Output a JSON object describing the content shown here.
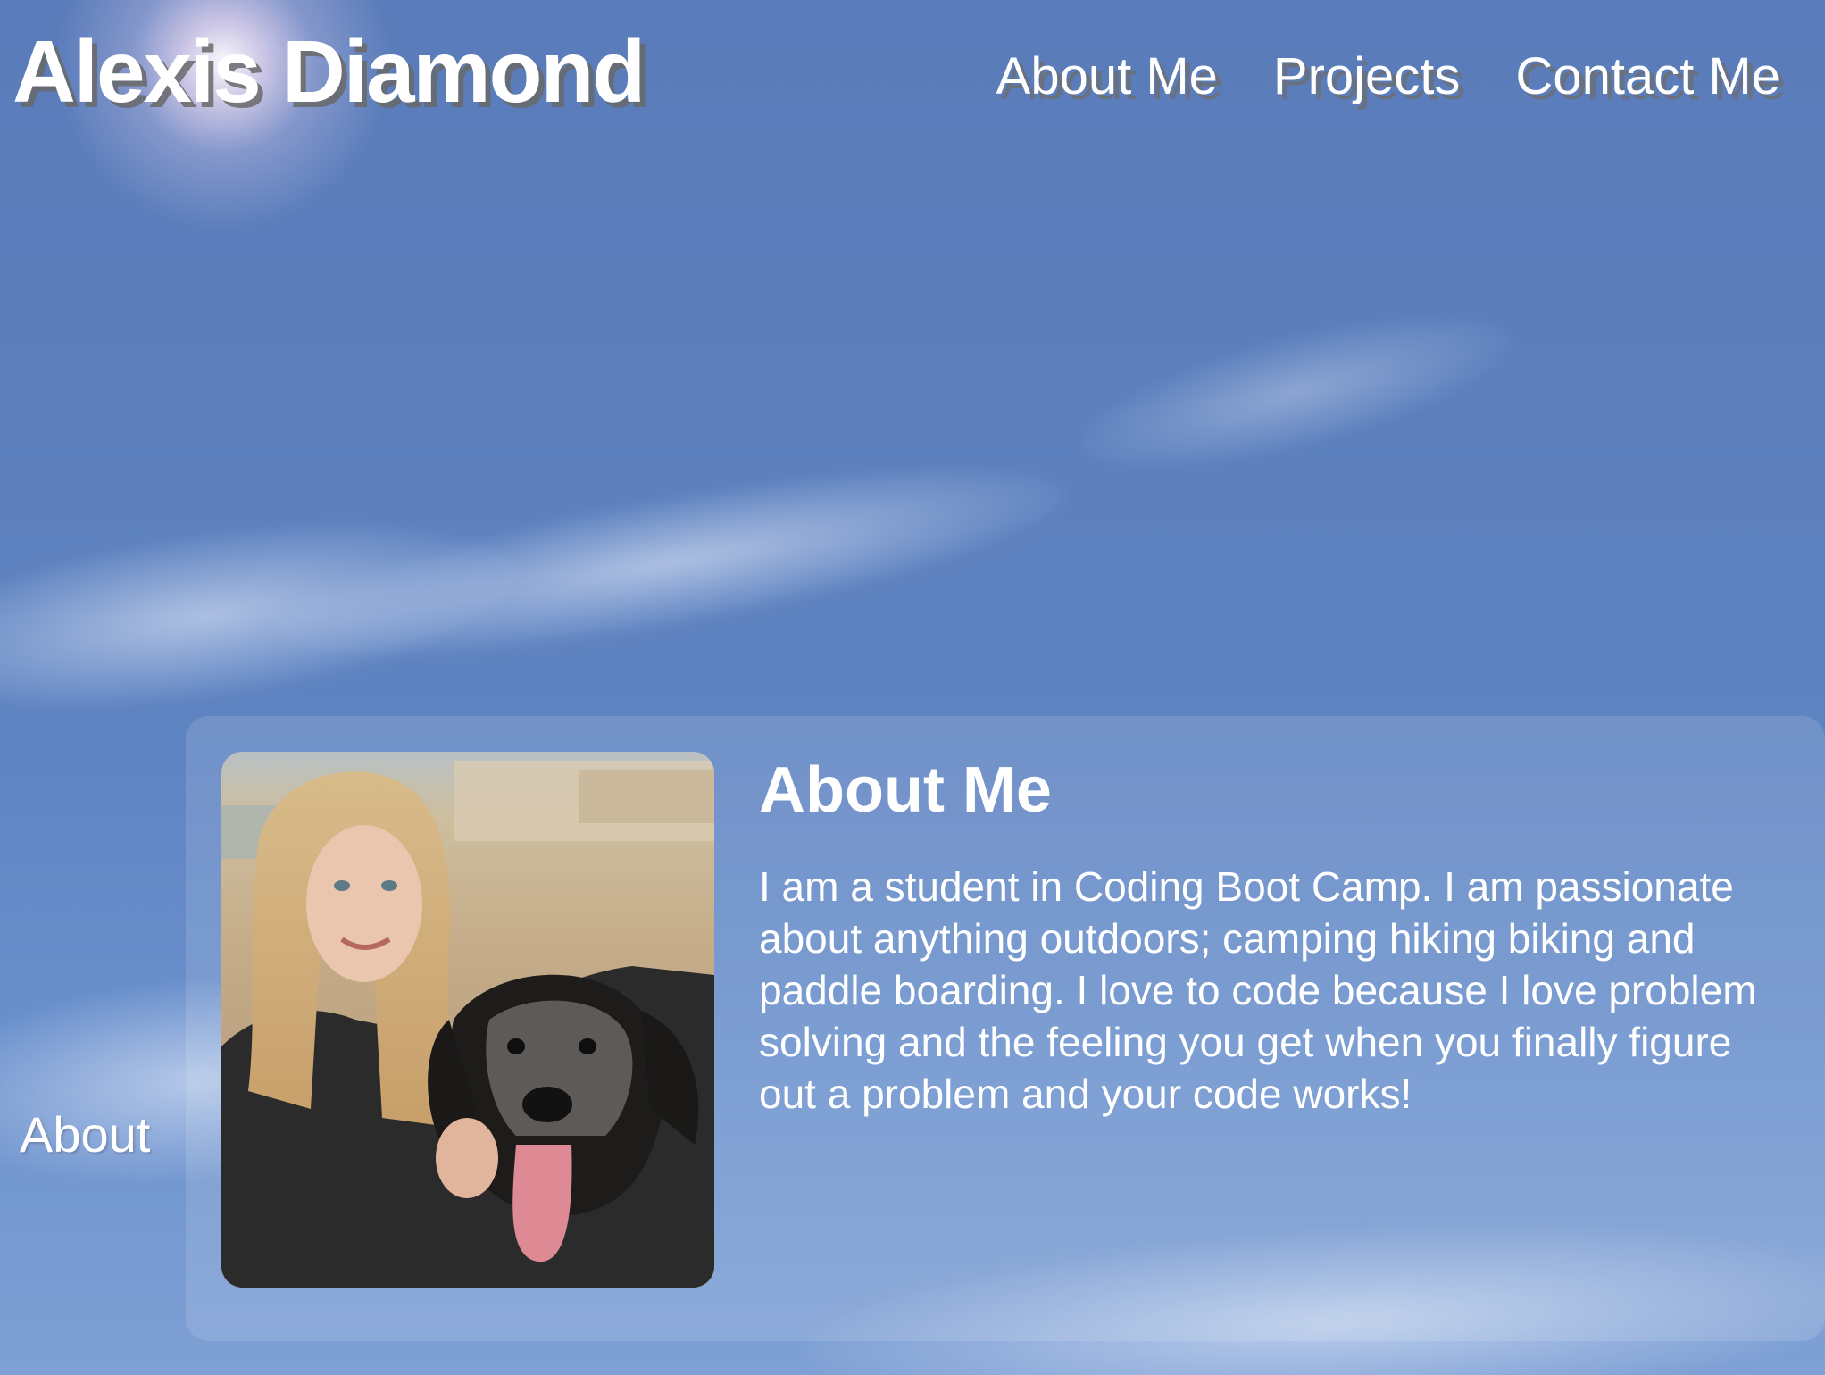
{
  "header": {
    "site_title": "Alexis Diamond",
    "nav": [
      {
        "label": "About Me"
      },
      {
        "label": "Projects"
      },
      {
        "label": "Contact Me"
      }
    ]
  },
  "side_label": "About",
  "about": {
    "title": "About Me",
    "text": "I am a student in Coding Boot Camp. I am passionate about anything outdoors; camping hiking biking and paddle boarding. I love to code because I love problem solving and the feeling you get when you finally figure out a problem and your code works!",
    "photo_icon": "profile-photo"
  },
  "colors": {
    "sky": "#5d80bd",
    "text": "#ffffff",
    "title_shadow": "#696969"
  }
}
